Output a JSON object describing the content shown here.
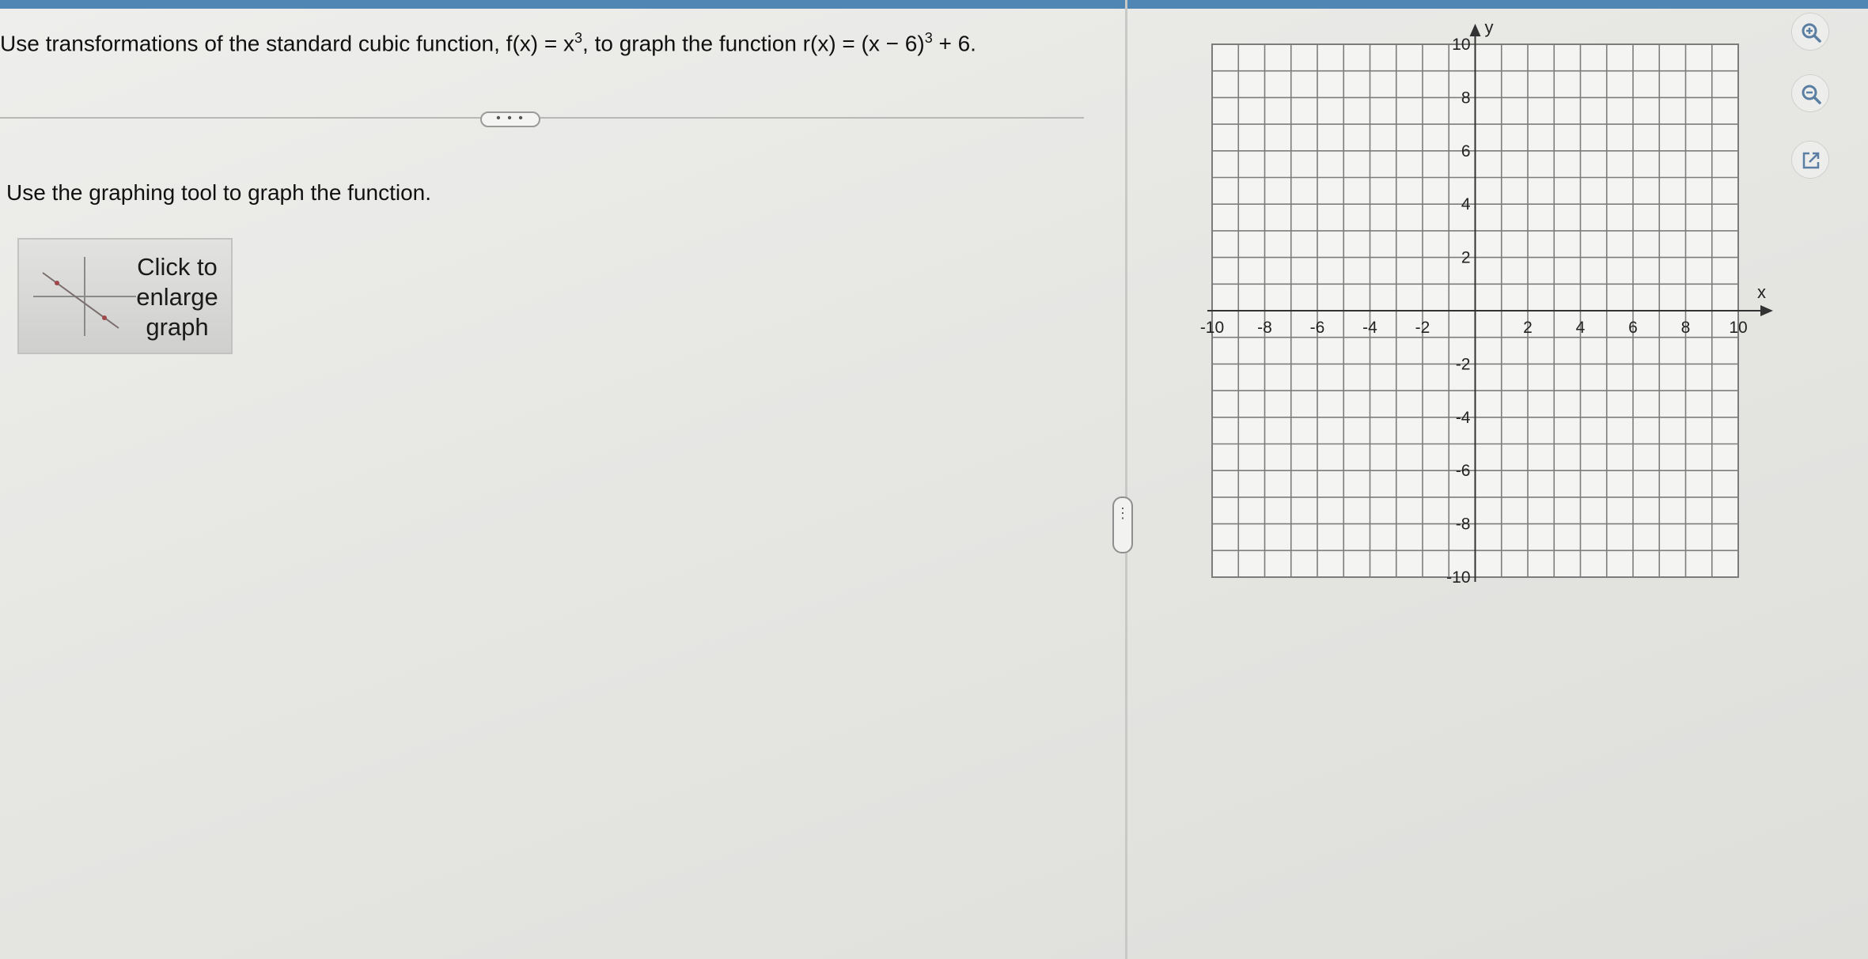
{
  "question": {
    "part1": "Use transformations of the standard cubic function, f(x) = x",
    "sup1": "3",
    "part2": ", to graph the function r(x) = (x − 6)",
    "sup2": "3",
    "part3": " + 6."
  },
  "more_button": {
    "label": "• • •"
  },
  "instruction": "Use the graphing tool to graph the function.",
  "enlarge": {
    "line1": "Click to",
    "line2": "enlarge",
    "line3": "graph"
  },
  "split_handle": {
    "label": "⋮"
  },
  "graph": {
    "x_axis_label": "x",
    "y_axis_label": "y",
    "x_ticks": [
      "-10",
      "-8",
      "-6",
      "-4",
      "-2",
      "2",
      "4",
      "6",
      "8",
      "10"
    ],
    "y_ticks": [
      "10",
      "8",
      "6",
      "4",
      "2",
      "-2",
      "-4",
      "-6",
      "-8",
      "-10"
    ],
    "x_range": [
      -10,
      10
    ],
    "y_range": [
      -10,
      10
    ],
    "grid_step": 1
  },
  "tools": {
    "zoom_in_icon": "zoom-in-icon",
    "zoom_out_icon": "zoom-out-icon",
    "open_external_icon": "external-link-icon"
  }
}
